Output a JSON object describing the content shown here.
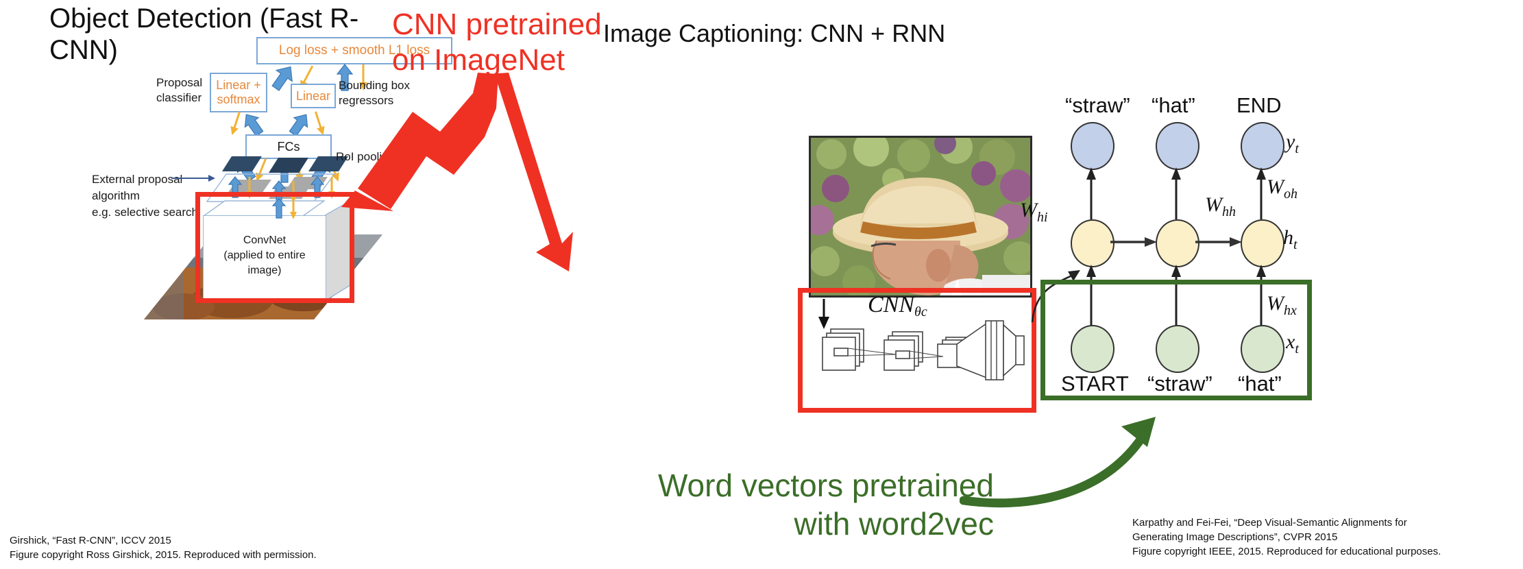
{
  "slide": {
    "left_title": "Object Detection\n(Fast R-CNN)",
    "right_title": "Image Captioning: CNN + RNN"
  },
  "annotations": {
    "cnn_pretrained": "CNN pretrained\non ImageNet",
    "cnn_pretrained_color": "#ef3124",
    "word2vec": "Word vectors pretrained\nwith word2vec",
    "word2vec_color": "#3b6e28"
  },
  "fast_rcnn": {
    "loss_box": "Log loss + smooth  L1 loss",
    "linear_softmax_box": "Linear +\nsoftmax",
    "linear_box": "Linear",
    "fcs_box": "FCs",
    "proposal_classifier_label": "Proposal\nclassifier",
    "bbox_regressors_label": "Bounding box\nregressors",
    "roi_pooling_label": "RoI pooling",
    "external_proposal_label": "External proposal\nalgorithm\ne.g. selective search",
    "convnet_box": "ConvNet\n(applied to entire\nimage)",
    "box_border_color": "#7ba7d7",
    "box_text_color": "#e8883a",
    "blue_arrow_color": "#5b9bd5",
    "yellow_arrow_color": "#f2b235",
    "highlight_color": "#ef3124"
  },
  "captioning": {
    "cnn_label": "CNN",
    "cnn_subscript": "θc",
    "outputs": [
      "“straw”",
      "“hat”",
      "END"
    ],
    "inputs": [
      "START",
      "“straw”",
      "“hat”"
    ],
    "weights": {
      "w_hi": "W",
      "w_hi_sub": "hi",
      "w_hh": "W",
      "w_hh_sub": "hh",
      "w_oh": "W",
      "w_oh_sub": "oh",
      "w_hx": "W",
      "w_hx_sub": "hx",
      "y_t": "y",
      "y_t_sub": "t",
      "h_t": "h",
      "h_t_sub": "t",
      "x_t": "x",
      "x_t_sub": "t"
    },
    "output_node_color": "#c3d0ea",
    "hidden_node_color": "#fbf0c8",
    "input_node_color": "#d8e7cd",
    "cnn_highlight_color": "#ef3124",
    "input_highlight_color": "#3b6e28"
  },
  "footers": {
    "left": "Girshick, “Fast R-CNN”, ICCV 2015\nFigure copyright Ross Girshick, 2015. Reproduced with permission.",
    "right": "Karpathy and Fei-Fei, “Deep Visual-Semantic Alignments for\nGenerating Image Descriptions”, CVPR 2015\nFigure copyright IEEE, 2015. Reproduced for educational purposes."
  }
}
